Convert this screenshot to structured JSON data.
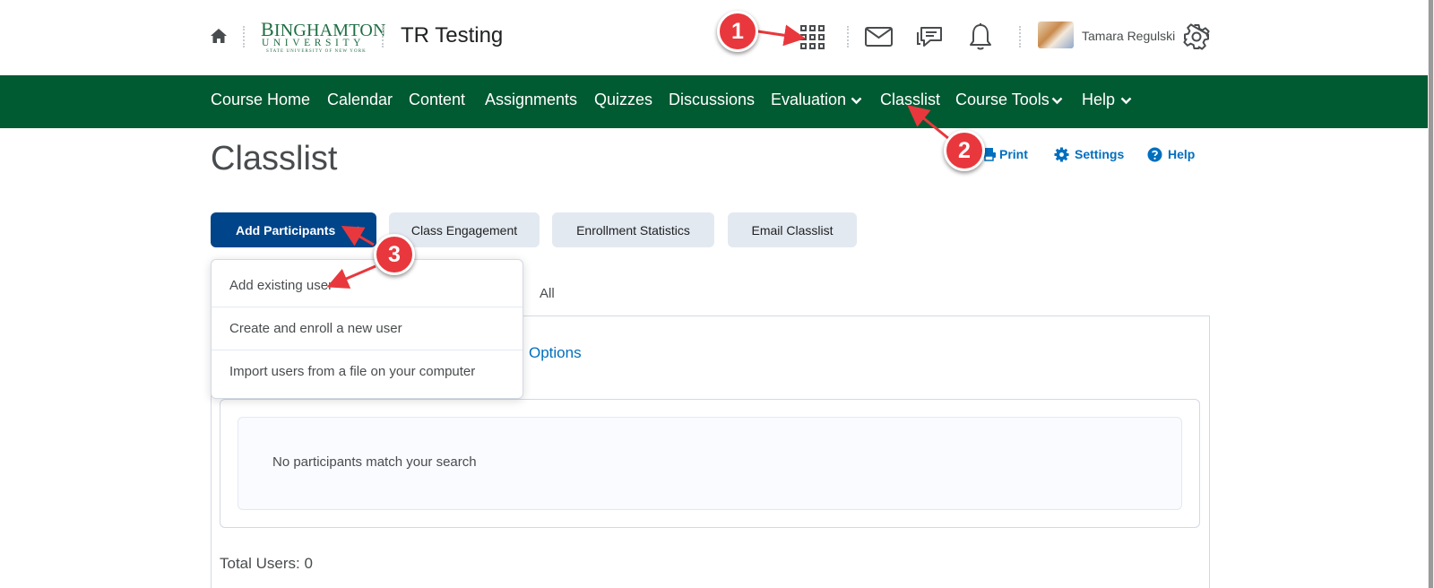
{
  "header": {
    "logo": {
      "line1_first": "B",
      "line1_rest": "INGHAMTON",
      "line2": "UNIVERSITY",
      "line3": "STATE UNIVERSITY OF NEW YORK"
    },
    "course_title": "TR Testing",
    "user_name": "Tamara Regulski",
    "icons": [
      "home-icon",
      "app-grid-icon",
      "mail-icon",
      "chat-icon",
      "bell-icon",
      "gear-icon"
    ]
  },
  "nav": {
    "items": [
      "Course Home",
      "Calendar",
      "Content",
      "Assignments",
      "Quizzes",
      "Discussions",
      "Evaluation",
      "Classlist",
      "Course Tools",
      "Help"
    ]
  },
  "page": {
    "title": "Classlist",
    "links": {
      "print": "Print",
      "settings": "Settings",
      "help": "Help"
    }
  },
  "toolbar": {
    "add_participants": "Add Participants",
    "class_engagement": "Class Engagement",
    "enrollment_statistics": "Enrollment Statistics",
    "email_classlist": "Email Classlist"
  },
  "dropdown": {
    "items": [
      "Add existing user",
      "Create and enroll a new user",
      "Import users from a file on your computer"
    ]
  },
  "main": {
    "tab_all": "All",
    "options_link": "Options",
    "empty_message": "No participants match your search",
    "total_users": "Total Users: 0"
  },
  "callouts": [
    "1",
    "2",
    "3"
  ],
  "colors": {
    "nav_bg": "#005a32",
    "primary_button": "#004489",
    "link": "#006fbf",
    "callout": "#e8383d"
  }
}
